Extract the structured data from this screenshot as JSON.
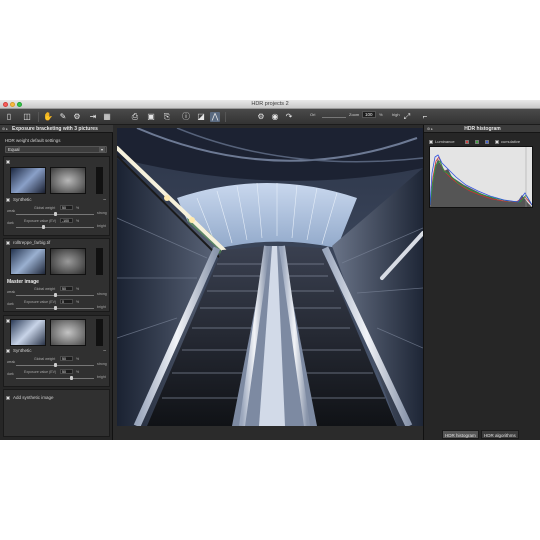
{
  "window": {
    "title": "HDR projects 2"
  },
  "toolbar": {
    "zoom_label": "Zoom",
    "zoom_value": "100",
    "percent": "%",
    "left_label": "Ori",
    "right_label": "high"
  },
  "left_panel": {
    "header": "Exposure bracketing with 3 pictures",
    "weight_section_label": "HDR weight default settings",
    "weight_preset": "Equal",
    "cards": [
      {
        "type_label": "Synthetic",
        "global_weight_label": "Global weight",
        "global_weight_value": "50",
        "unit_percent": "%",
        "weak_label": "weak",
        "strong_label": "strong",
        "exposure_label": "Exposure value (EV)",
        "exposure_value": "-100",
        "exposure_unit": "%",
        "dark_label": "dark",
        "bright_label": "bright"
      },
      {
        "file_name": "rolltreppe_farbig.tif",
        "master_label": "Master image",
        "global_weight_label": "Global weight",
        "global_weight_value": "50",
        "unit_percent": "%",
        "weak_label": "weak",
        "strong_label": "strong",
        "exposure_label": "Exposure value (EV)",
        "exposure_value": "0",
        "exposure_unit": "%",
        "dark_label": "dark",
        "bright_label": "bright"
      },
      {
        "type_label": "Synthetic",
        "global_weight_label": "Global weight",
        "global_weight_value": "50",
        "unit_percent": "%",
        "weak_label": "weak",
        "strong_label": "strong",
        "exposure_label": "Exposure value (EV)",
        "exposure_value": "50",
        "exposure_unit": "%",
        "dark_label": "dark",
        "bright_label": "bright"
      }
    ],
    "add_synthetic_label": "Add synthetic image"
  },
  "right_panel": {
    "header": "HDR histogram",
    "luminance_label": "Luminance",
    "cumulative_label": "cumulative",
    "channel_labels": [
      "R",
      "G",
      "B"
    ],
    "tabs": [
      "HDR histogram",
      "HDR algorithms"
    ]
  },
  "colors": {
    "accent": "#6a9fd8",
    "panel_bg": "#262626",
    "window_bg": "#2b2b2b"
  }
}
